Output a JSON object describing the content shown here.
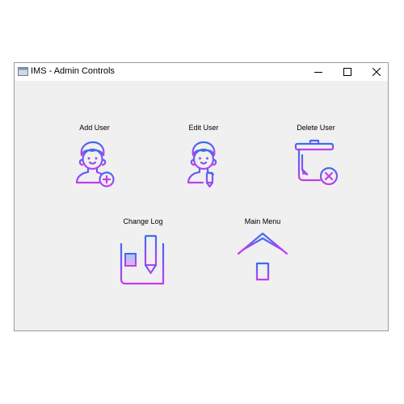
{
  "window": {
    "title": "IMS - Admin Controls",
    "app_icon": "window-app-icon",
    "controls": {
      "minimize_icon": "minimize-icon",
      "maximize_icon": "maximize-icon",
      "close_icon": "close-icon"
    }
  },
  "tiles": [
    {
      "label": "Add User",
      "icon": "add-user-icon"
    },
    {
      "label": "Edit User",
      "icon": "edit-user-icon"
    },
    {
      "label": "Delete User",
      "icon": "delete-user-icon"
    },
    {
      "label": "Change Log",
      "icon": "change-log-icon"
    },
    {
      "label": "Main Menu",
      "icon": "home-icon"
    }
  ],
  "colors": {
    "icon_gradient_start": "#3c6cf0",
    "icon_gradient_end": "#c43cf0",
    "window_background": "#f0f0f0"
  }
}
